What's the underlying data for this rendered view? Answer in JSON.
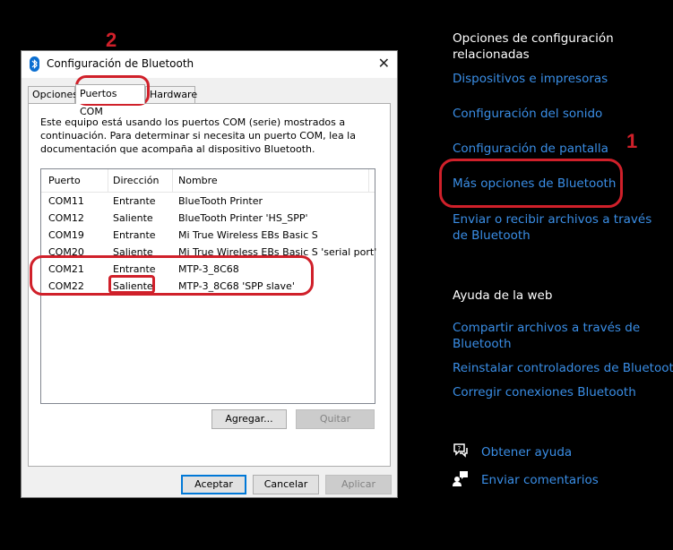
{
  "settings_panel": {
    "related_heading": "Opciones de configuración relacionadas",
    "links": [
      "Dispositivos e impresoras",
      "Configuración del sonido",
      "Configuración de pantalla",
      "Más opciones de Bluetooth",
      "Enviar o recibir archivos a través de Bluetooth"
    ],
    "web_help_heading": "Ayuda de la web",
    "web_links": [
      "Compartir archivos a través de Bluetooth",
      "Reinstalar controladores de Bluetooth",
      "Corregir conexiones Bluetooth"
    ],
    "get_help": "Obtener ayuda",
    "send_feedback": "Enviar comentarios"
  },
  "dialog": {
    "title": "Configuración de Bluetooth",
    "tabs": [
      "Opciones",
      "Puertos COM",
      "Hardware"
    ],
    "active_tab": "Puertos COM",
    "description": "Este equipo está usando los puertos COM (serie) mostrados a continuación. Para determinar si necesita un puerto COM, lea la documentación que acompaña al dispositivo Bluetooth.",
    "columns": [
      "Puerto",
      "Dirección",
      "Nombre"
    ],
    "ports": [
      {
        "port": "COM11",
        "direction": "Entrante",
        "name": "BlueTooth Printer"
      },
      {
        "port": "COM12",
        "direction": "Saliente",
        "name": "BlueTooth Printer 'HS_SPP'"
      },
      {
        "port": "COM19",
        "direction": "Entrante",
        "name": "Mi True Wireless EBs Basic S"
      },
      {
        "port": "COM20",
        "direction": "Saliente",
        "name": "Mi True Wireless EBs Basic S 'serial port'"
      },
      {
        "port": "COM21",
        "direction": "Entrante",
        "name": "MTP-3_8C68"
      },
      {
        "port": "COM22",
        "direction": "Saliente",
        "name": "MTP-3_8C68 'SPP slave'"
      }
    ],
    "buttons": {
      "add": "Agregar...",
      "remove": "Quitar",
      "ok": "Aceptar",
      "cancel": "Cancelar",
      "apply": "Aplicar"
    }
  },
  "annotations": {
    "marker_1": "1",
    "marker_2": "2"
  },
  "colors": {
    "link": "#3a8ee6",
    "annotation": "#d0202a",
    "background": "#000000"
  }
}
